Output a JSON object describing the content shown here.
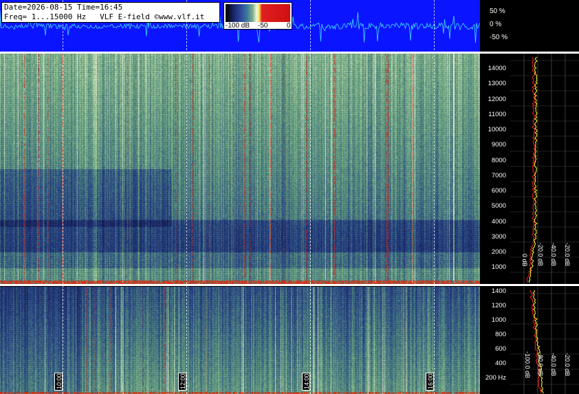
{
  "header": {
    "line1": "Date=2026-08-15 Time=16:45",
    "line2": "Freq= 1...15000 Hz   VLF E-field ©www.vlf.it"
  },
  "colorbar": {
    "labels": [
      "-100 dB",
      "-50",
      "0"
    ]
  },
  "waveform_scale": {
    "labels": [
      "50 %",
      "0 %",
      "-50 %"
    ]
  },
  "freq_axis_hi": {
    "labels": [
      "14000",
      "13000",
      "12000",
      "11000",
      "10000",
      "9000",
      "8000",
      "7000",
      "6000",
      "5000",
      "4000",
      "3000",
      "2000",
      "1000"
    ]
  },
  "freq_axis_lo": {
    "labels": [
      "1400",
      "1200",
      "1000",
      "800",
      "600",
      "400",
      "200 Hz"
    ]
  },
  "profile_hi": {
    "labels": [
      "0 dB",
      "-20.0 dB",
      "-40.0 dB",
      "-20.0 dB"
    ]
  },
  "profile_lo": {
    "labels": [
      "-100.0 dB",
      "-80.0 dB",
      "-40.0 dB",
      "-20.0 dB"
    ]
  },
  "time_axis": {
    "labels": [
      "10:00",
      "12:00",
      "14:00",
      "16:00"
    ]
  },
  "colors": {
    "waveform_bg": "#0a14ff",
    "trace": "#40e0ff",
    "spectrogram_low": "#1f2a6a",
    "spectrogram_high": "#7fb08a",
    "hot": "#e02020",
    "profile_trace_1": "#ff2020",
    "profile_trace_2": "#ffff40"
  }
}
